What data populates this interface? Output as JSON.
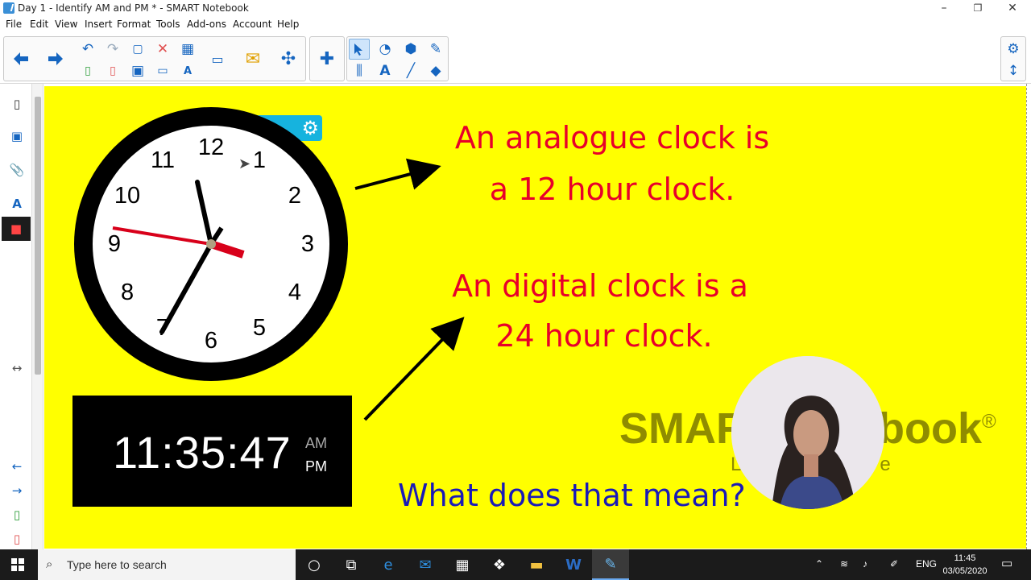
{
  "window": {
    "title": "Day 1 - Identify AM and PM * - SMART Notebook",
    "minimize": "–",
    "restore": "❐",
    "close": "✕"
  },
  "menu": [
    "File",
    "Edit",
    "View",
    "Insert",
    "Format",
    "Tools",
    "Add-ons",
    "Account",
    "Help"
  ],
  "slide": {
    "clock_numbers": [
      "12",
      "1",
      "2",
      "3",
      "4",
      "5",
      "6",
      "7",
      "8",
      "9",
      "10",
      "11"
    ],
    "digital_time": "11:35:47",
    "am_label": "AM",
    "pm_label": "PM",
    "analogue_line1": "An analogue clock is",
    "analogue_line2": "a 12 hour clock.",
    "digital_line1": "An digital clock is a",
    "digital_line2": "24 hour clock.",
    "question": "What does that mean?",
    "brand_left": "SMAR",
    "brand_right": "book",
    "brand_reg": "®",
    "brand_sub_left": "L",
    "brand_sub_right": "e"
  },
  "taskbar": {
    "search_placeholder": "Type here to search",
    "language": "ENG",
    "time": "11:45",
    "date": "03/05/2020"
  },
  "colors": {
    "canvas": "#ffff00",
    "red_text": "#e8002a",
    "blue_text": "#1a1ab8",
    "second_hand": "#d8001a"
  },
  "icons": [
    "undo-icon",
    "redo-icon",
    "select-icon",
    "text-icon",
    "eraser-icon",
    "gear-icon"
  ]
}
